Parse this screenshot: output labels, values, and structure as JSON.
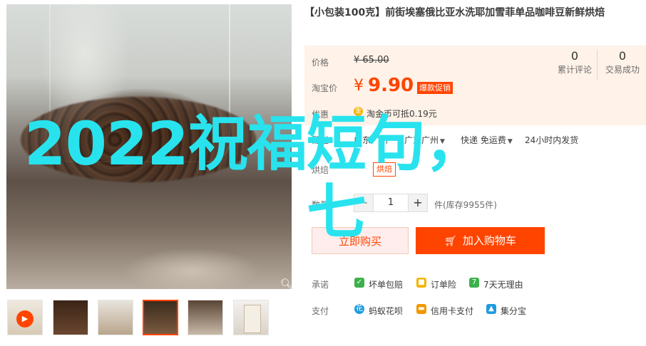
{
  "product": {
    "title": "【小包装100克】前街埃塞俄比亚水洗耶加雪菲单品咖啡豆新鲜烘焙"
  },
  "overlay": {
    "line1": "2022祝福短句，",
    "line2": "七"
  },
  "price": {
    "label": "价格",
    "original": "¥ 65.00",
    "taobao_label": "淘宝价",
    "currency": "¥",
    "current": "9.90",
    "promo_tag": "爆款促销",
    "offer_label": "优惠",
    "coin_text": "淘金币可抵",
    "coin_value": "0.19元"
  },
  "stats": {
    "reviews_count": "0",
    "reviews_label": "累计评论",
    "trades_count": "0",
    "trades_label": "交易成功"
  },
  "shipping": {
    "label": "配送",
    "from": "广东广州",
    "to": "广东广州",
    "delivery": "快递 免运费",
    "timing": "24小时内发货"
  },
  "taste": {
    "label": "烘焙",
    "option": "烘焙"
  },
  "quantity": {
    "label": "数量",
    "minus": "−",
    "value": "1",
    "plus": "+",
    "stock": "件(库存9955件)"
  },
  "actions": {
    "buy_now": "立即购买",
    "add_cart": "加入购物车"
  },
  "promises": {
    "label": "承诺",
    "items": [
      {
        "icon": "shield-icon",
        "text": "坏单包赔",
        "color": "#3db04b"
      },
      {
        "icon": "lock-icon",
        "text": "订单险",
        "color": "#f5b400"
      },
      {
        "icon": "seven-day-icon",
        "text": "7天无理由",
        "color": "#3db04b"
      }
    ]
  },
  "payment": {
    "label": "支付",
    "items": [
      {
        "icon": "huabei-icon",
        "text": "蚂蚁花呗",
        "color": "#1f9bde"
      },
      {
        "icon": "credit-card-icon",
        "text": "信用卡支付",
        "color": "#f39800"
      },
      {
        "icon": "jifen-icon",
        "text": "集分宝",
        "color": "#1f9bde"
      }
    ]
  },
  "colors": {
    "accent": "#ff4400",
    "overlay_text": "#28e3ee",
    "price_bg": "#fff2e8"
  }
}
